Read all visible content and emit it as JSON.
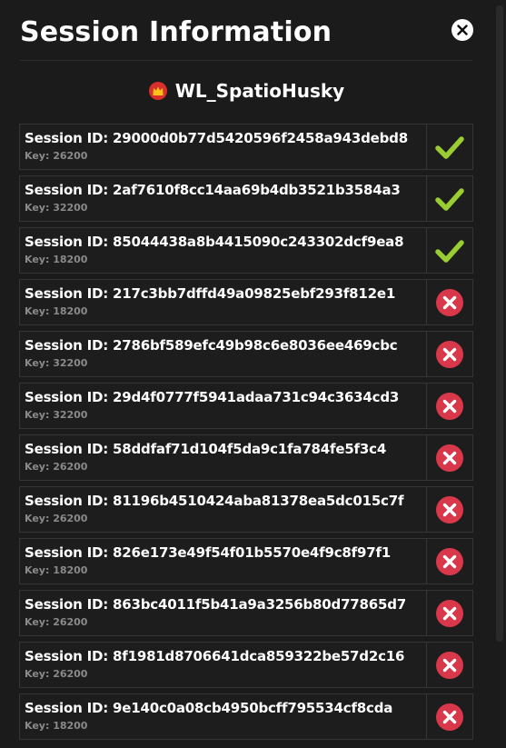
{
  "dialog": {
    "title": "Session Information"
  },
  "user": {
    "name": "WL_SpatioHusky",
    "badge_icon": "crown-badge-icon"
  },
  "colors": {
    "valid": "#9acd32",
    "invalid": "#d9384a",
    "background": "#1b1b1b"
  },
  "sessions": [
    {
      "id_text": "Session ID: 29000d0b77d5420596f2458a943debd8",
      "key_text": "Key: 26200",
      "status": "valid"
    },
    {
      "id_text": "Session ID: 2af7610f8cc14aa69b4db3521b3584a3",
      "key_text": "Key: 32200",
      "status": "valid"
    },
    {
      "id_text": "Session ID: 85044438a8b4415090c243302dcf9ea8",
      "key_text": "Key: 18200",
      "status": "valid"
    },
    {
      "id_text": "Session ID: 217c3bb7dffd49a09825ebf293f812e1",
      "key_text": "Key: 18200",
      "status": "invalid"
    },
    {
      "id_text": "Session ID: 2786bf589efc49b98c6e8036ee469cbc",
      "key_text": "Key: 32200",
      "status": "invalid"
    },
    {
      "id_text": "Session ID: 29d4f0777f5941adaa731c94c3634cd3",
      "key_text": "Key: 32200",
      "status": "invalid"
    },
    {
      "id_text": "Session ID: 58ddfaf71d104f5da9c1fa784fe5f3c4",
      "key_text": "Key: 26200",
      "status": "invalid"
    },
    {
      "id_text": "Session ID: 81196b4510424aba81378ea5dc015c7f",
      "key_text": "Key: 26200",
      "status": "invalid"
    },
    {
      "id_text": "Session ID: 826e173e49f54f01b5570e4f9c8f97f1",
      "key_text": "Key: 18200",
      "status": "invalid"
    },
    {
      "id_text": "Session ID: 863bc4011f5b41a9a3256b80d77865d7",
      "key_text": "Key: 26200",
      "status": "invalid"
    },
    {
      "id_text": "Session ID: 8f1981d8706641dca859322be57d2c16",
      "key_text": "Key: 26200",
      "status": "invalid"
    },
    {
      "id_text": "Session ID: 9e140c0a08cb4950bcff795534cf8cda",
      "key_text": "Key: 18200",
      "status": "invalid"
    }
  ]
}
